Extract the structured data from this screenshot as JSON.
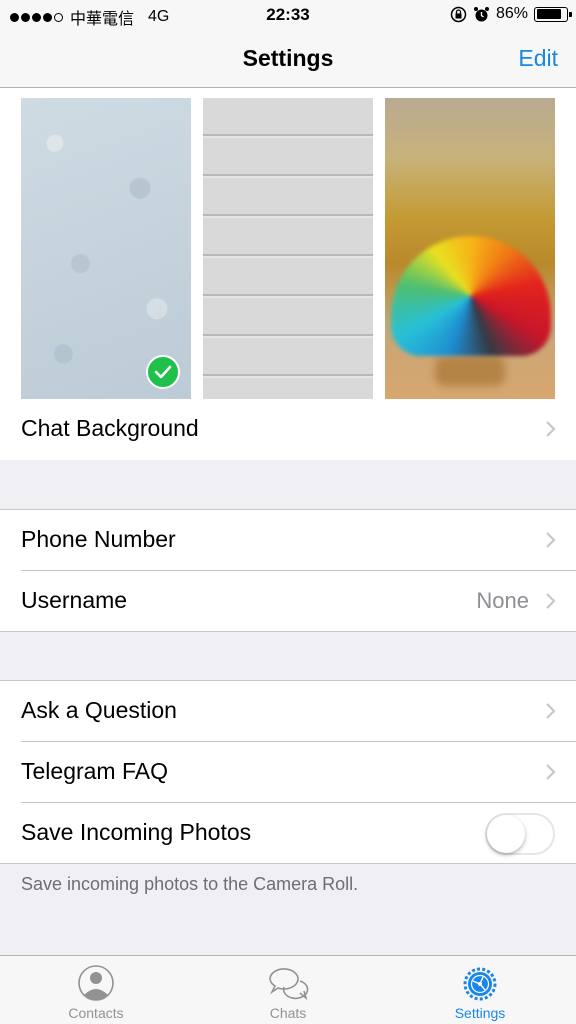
{
  "status_bar": {
    "carrier": "中華電信",
    "network": "4G",
    "time": "22:33",
    "battery": "86%",
    "battery_level": 0.86,
    "signal_bars_filled": 4
  },
  "navbar": {
    "title": "Settings",
    "edit_label": "Edit"
  },
  "wallpapers": {
    "selected_index": 0,
    "accent_check_color": "#20c14a"
  },
  "sections": {
    "chat_background": {
      "label": "Chat Background"
    },
    "phone_number": {
      "label": "Phone Number"
    },
    "username": {
      "label": "Username",
      "value": "None"
    },
    "ask_question": {
      "label": "Ask a Question"
    },
    "telegram_faq": {
      "label": "Telegram FAQ"
    },
    "save_photos": {
      "label": "Save Incoming Photos",
      "enabled": false
    }
  },
  "footnote": "Save incoming photos to the Camera Roll.",
  "tabbar": {
    "tabs": [
      {
        "label": "Contacts",
        "icon": "contacts-icon",
        "active": false
      },
      {
        "label": "Chats",
        "icon": "chats-icon",
        "active": false
      },
      {
        "label": "Settings",
        "icon": "settings-icon",
        "active": true
      }
    ]
  },
  "colors": {
    "accent": "#1a87e8",
    "background": "#efeff4",
    "inactive_tab": "#929292"
  }
}
